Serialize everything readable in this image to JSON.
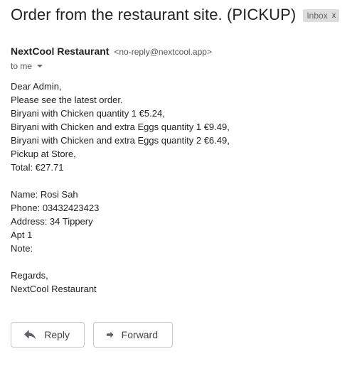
{
  "email": {
    "subject": "Order from the restaurant site. (PICKUP)",
    "label": {
      "text": "Inbox",
      "close_glyph": "x"
    },
    "sender": {
      "name": "NextCool Restaurant",
      "address": "<no-reply@nextcool.app>"
    },
    "recipient_text": "to me",
    "body_lines": [
      "Dear Admin,",
      "Please see the latest order.",
      "Biryani with Chicken quantity 1 €5.24,",
      "Biryani with Chicken and extra Eggs quantity 1 €9.49,",
      "Biryani with Chicken and extra Eggs quantity 2 €6.49,",
      "Pickup at Store,",
      "Total: €27.71",
      "",
      "Name: Rosi Sah",
      "Phone: 03432423423",
      "Address: 34 Tippery",
      "Apt 1",
      "Note:",
      "",
      "Regards,",
      "NextCool Restaurant"
    ]
  },
  "actions": {
    "reply_label": "Reply",
    "forward_label": "Forward",
    "reply_icon": "reply-arrow-icon",
    "forward_icon": "forward-arrow-icon"
  }
}
